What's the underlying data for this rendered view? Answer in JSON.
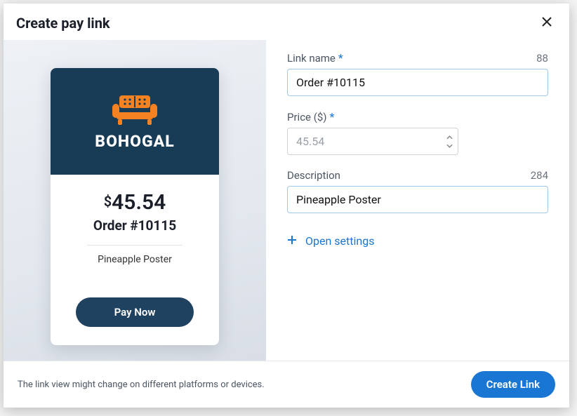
{
  "header": {
    "title": "Create pay link"
  },
  "preview": {
    "brand": "BOHOGAL",
    "currency_symbol": "$",
    "price": "45.54",
    "order_label": "Order #10115",
    "description": "Pineapple Poster",
    "pay_button": "Pay Now"
  },
  "form": {
    "link_name": {
      "label": "Link name",
      "value": "Order #10115",
      "counter": "88"
    },
    "price": {
      "label": "Price ($)",
      "value": "45.54"
    },
    "description": {
      "label": "Description",
      "value": "Pineapple Poster",
      "counter": "284"
    },
    "open_settings": "Open settings"
  },
  "footer": {
    "note": "The link view might change on different platforms or devices.",
    "create_button": "Create Link"
  }
}
